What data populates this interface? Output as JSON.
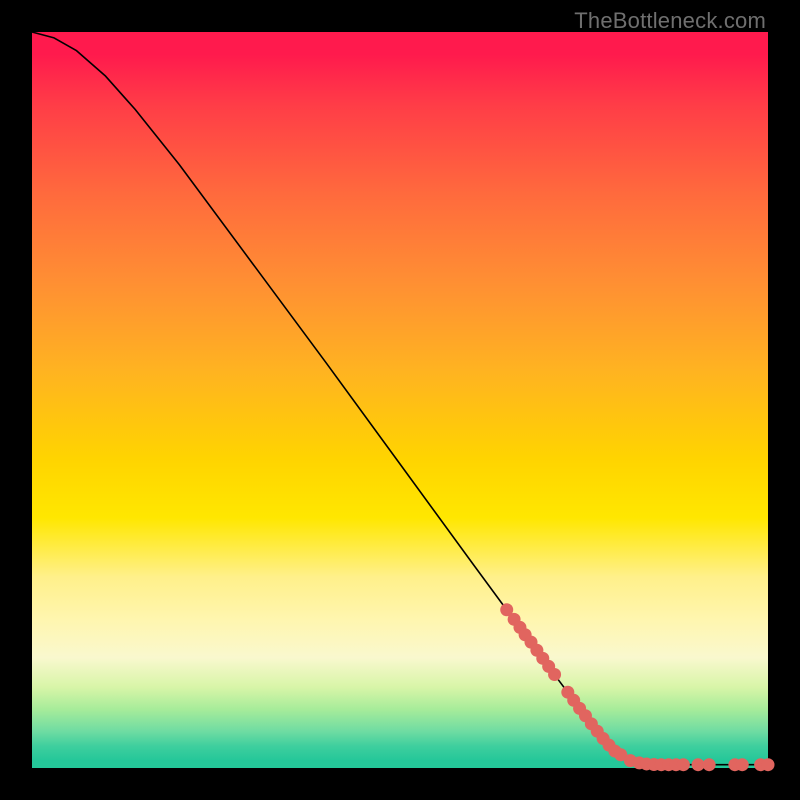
{
  "attribution": "TheBottleneck.com",
  "chart_data": {
    "type": "line",
    "title": "",
    "xlabel": "",
    "ylabel": "",
    "xlim": [
      0,
      100
    ],
    "ylim": [
      0,
      100
    ],
    "curve": [
      {
        "x": 0,
        "y": 100.0
      },
      {
        "x": 3,
        "y": 99.2
      },
      {
        "x": 6,
        "y": 97.5
      },
      {
        "x": 10,
        "y": 94.0
      },
      {
        "x": 14,
        "y": 89.5
      },
      {
        "x": 20,
        "y": 82.0
      },
      {
        "x": 30,
        "y": 68.5
      },
      {
        "x": 40,
        "y": 55.0
      },
      {
        "x": 50,
        "y": 41.3
      },
      {
        "x": 60,
        "y": 27.6
      },
      {
        "x": 70,
        "y": 14.0
      },
      {
        "x": 76,
        "y": 6.0
      },
      {
        "x": 80,
        "y": 1.8
      },
      {
        "x": 82,
        "y": 0.7
      },
      {
        "x": 85,
        "y": 0.45
      },
      {
        "x": 90,
        "y": 0.45
      },
      {
        "x": 95,
        "y": 0.45
      },
      {
        "x": 100,
        "y": 0.45
      }
    ],
    "highlight_points": [
      {
        "x": 64.5,
        "y": 21.5
      },
      {
        "x": 65.5,
        "y": 20.2
      },
      {
        "x": 66.3,
        "y": 19.1
      },
      {
        "x": 67.0,
        "y": 18.1
      },
      {
        "x": 67.8,
        "y": 17.1
      },
      {
        "x": 68.6,
        "y": 16.0
      },
      {
        "x": 69.4,
        "y": 14.9
      },
      {
        "x": 70.2,
        "y": 13.8
      },
      {
        "x": 71.0,
        "y": 12.7
      },
      {
        "x": 72.8,
        "y": 10.3
      },
      {
        "x": 73.6,
        "y": 9.2
      },
      {
        "x": 74.4,
        "y": 8.1
      },
      {
        "x": 75.2,
        "y": 7.1
      },
      {
        "x": 76.0,
        "y": 6.0
      },
      {
        "x": 76.8,
        "y": 5.0
      },
      {
        "x": 77.6,
        "y": 4.0
      },
      {
        "x": 78.4,
        "y": 3.1
      },
      {
        "x": 79.2,
        "y": 2.3
      },
      {
        "x": 80.0,
        "y": 1.8
      },
      {
        "x": 81.3,
        "y": 1.0
      },
      {
        "x": 82.5,
        "y": 0.7
      },
      {
        "x": 83.5,
        "y": 0.55
      },
      {
        "x": 84.5,
        "y": 0.48
      },
      {
        "x": 85.5,
        "y": 0.45
      },
      {
        "x": 86.5,
        "y": 0.45
      },
      {
        "x": 87.5,
        "y": 0.45
      },
      {
        "x": 88.5,
        "y": 0.45
      },
      {
        "x": 90.5,
        "y": 0.45
      },
      {
        "x": 92.0,
        "y": 0.45
      },
      {
        "x": 95.5,
        "y": 0.45
      },
      {
        "x": 96.5,
        "y": 0.45
      },
      {
        "x": 99.0,
        "y": 0.45
      },
      {
        "x": 100.0,
        "y": 0.45
      }
    ],
    "highlight_color": "#e1655f",
    "highlight_radius": 6.5
  }
}
